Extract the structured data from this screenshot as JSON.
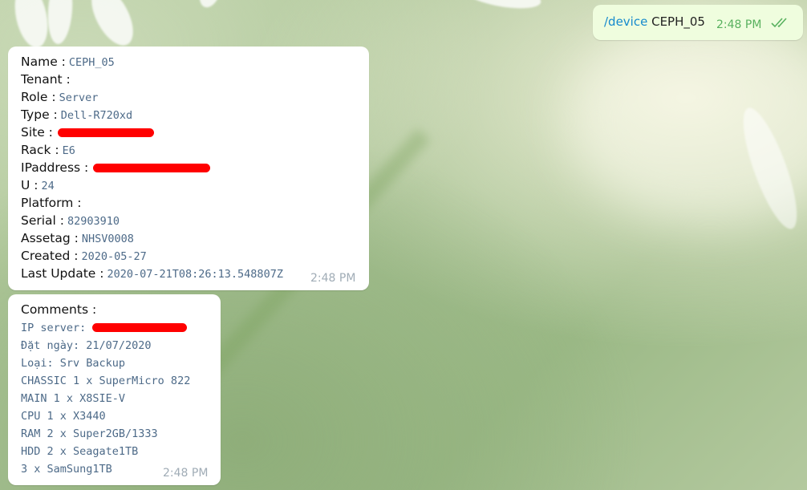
{
  "outgoing": {
    "command": "/device",
    "argument": " CEPH_05",
    "time": "2:48 PM",
    "status_icon": "double-check-icon"
  },
  "device_message": {
    "fields": [
      {
        "label": "Name :",
        "value": "CEPH_05"
      },
      {
        "label": "Tenant :",
        "value": ""
      },
      {
        "label": "Role :",
        "value": "Server"
      },
      {
        "label": "Type :",
        "value": "Dell-R720xd"
      },
      {
        "label": "Site :",
        "value": ""
      },
      {
        "label": "Rack :",
        "value": "E6"
      },
      {
        "label": "IPaddress :",
        "value": ""
      },
      {
        "label": "U :",
        "value": "24"
      },
      {
        "label": "Platform :",
        "value": ""
      },
      {
        "label": "Serial :",
        "value": "82903910"
      },
      {
        "label": "Assetag :",
        "value": "NHSV0008"
      },
      {
        "label": "Created :",
        "value": "2020-05-27"
      },
      {
        "label": "Last Update :",
        "value": "2020-07-21T08:26:13.548807Z"
      }
    ],
    "time": "2:48 PM"
  },
  "comments_message": {
    "title": "Comments :",
    "lines": [
      "IP server:",
      "Đặt ngày: 21/07/2020",
      "Loại: Srv Backup",
      "CHASSIC 1 x SuperMicro 822",
      "MAIN 1 x X8SIE-V",
      "CPU 1 x X3440",
      "RAM 2 x Super2GB/1333",
      "HDD 2 x Seagate1TB",
      "3 x SamSung1TB"
    ],
    "time": "2:48 PM"
  },
  "colors": {
    "outgoing_bubble": "#effdde",
    "incoming_bubble": "#ffffff",
    "link": "#168acd",
    "mono_value": "#4d6a88",
    "redaction": "#ff0000",
    "read_check": "#59b15f"
  }
}
